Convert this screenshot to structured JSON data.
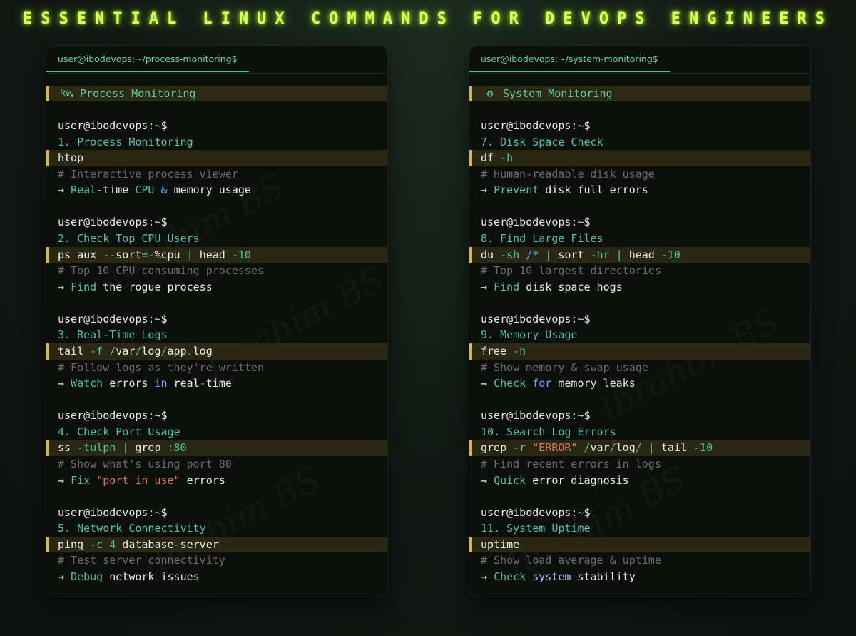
{
  "title": "ESSENTIAL LINUX COMMANDS FOR DEVOPS ENGINEERS",
  "watermark": "Ibrahim BS",
  "colors": {
    "accent_title": "#d8ff5a",
    "teal": "#4fc3a3",
    "highlight": "#d9b54a"
  },
  "panels": [
    {
      "tab": "user@ibodevops:~/process-monitoring$",
      "section_icon": "satellite-icon",
      "section_icon_glyph": "🛰",
      "section_title": "Process Monitoring",
      "entries": [
        {
          "prompt": "user@ibodevops:~$",
          "step": "1. Process Monitoring",
          "cmd": [
            {
              "t": "htop",
              "c": "white"
            }
          ],
          "comment": "# Interactive process viewer",
          "note": [
            {
              "t": "→ ",
              "c": "white"
            },
            {
              "t": "Real",
              "c": "teal"
            },
            {
              "t": "-",
              "c": "white"
            },
            {
              "t": "time ",
              "c": "white"
            },
            {
              "t": "CPU",
              "c": "teal"
            },
            {
              "t": " & ",
              "c": "blue"
            },
            {
              "t": "memory usage",
              "c": "white"
            }
          ]
        },
        {
          "prompt": "user@ibodevops:~$",
          "step": "2. Check Top CPU Users",
          "cmd": [
            {
              "t": "ps aux ",
              "c": "white"
            },
            {
              "t": "--",
              "c": "teal"
            },
            {
              "t": "sort",
              "c": "white"
            },
            {
              "t": "=-",
              "c": "teal"
            },
            {
              "t": "%cpu ",
              "c": "white"
            },
            {
              "t": "| ",
              "c": "teal"
            },
            {
              "t": "head ",
              "c": "white"
            },
            {
              "t": "-10",
              "c": "teal"
            }
          ],
          "comment": "# Top 10 CPU consuming processes",
          "note": [
            {
              "t": "→ ",
              "c": "white"
            },
            {
              "t": "Find",
              "c": "teal"
            },
            {
              "t": " the rogue process",
              "c": "white"
            }
          ]
        },
        {
          "prompt": "user@ibodevops:~$",
          "step": "3. Real-Time Logs",
          "cmd": [
            {
              "t": "tail ",
              "c": "white"
            },
            {
              "t": "-f ",
              "c": "teal"
            },
            {
              "t": "/",
              "c": "teal"
            },
            {
              "t": "var",
              "c": "white"
            },
            {
              "t": "/",
              "c": "teal"
            },
            {
              "t": "log",
              "c": "white"
            },
            {
              "t": "/",
              "c": "teal"
            },
            {
              "t": "app",
              "c": "white"
            },
            {
              "t": ".",
              "c": "teal"
            },
            {
              "t": "log",
              "c": "white"
            }
          ],
          "comment": "# Follow logs as they're written",
          "note": [
            {
              "t": "→ ",
              "c": "white"
            },
            {
              "t": "Watch",
              "c": "teal"
            },
            {
              "t": " errors ",
              "c": "white"
            },
            {
              "t": "in",
              "c": "blue"
            },
            {
              "t": " real",
              "c": "white"
            },
            {
              "t": "-",
              "c": "teal"
            },
            {
              "t": "time",
              "c": "white"
            }
          ]
        },
        {
          "prompt": "user@ibodevops:~$",
          "step": "4. Check Port Usage",
          "cmd": [
            {
              "t": "ss ",
              "c": "white"
            },
            {
              "t": "-tulpn ",
              "c": "teal"
            },
            {
              "t": "| ",
              "c": "teal"
            },
            {
              "t": "grep ",
              "c": "white"
            },
            {
              "t": ":80",
              "c": "teal"
            }
          ],
          "comment": "# Show what's using port 80",
          "note": [
            {
              "t": "→ ",
              "c": "white"
            },
            {
              "t": "Fix",
              "c": "teal"
            },
            {
              "t": " \"port in use\"",
              "c": "orange"
            },
            {
              "t": " errors",
              "c": "white"
            }
          ]
        },
        {
          "prompt": "user@ibodevops:~$",
          "step": "5. Network Connectivity",
          "cmd": [
            {
              "t": "ping ",
              "c": "white"
            },
            {
              "t": "-c ",
              "c": "teal"
            },
            {
              "t": "4",
              "c": "teal"
            },
            {
              "t": " database",
              "c": "white"
            },
            {
              "t": "-",
              "c": "teal"
            },
            {
              "t": "server",
              "c": "white"
            }
          ],
          "comment": "# Test server connectivity",
          "note": [
            {
              "t": "→ ",
              "c": "white"
            },
            {
              "t": "Debug",
              "c": "teal"
            },
            {
              "t": " network issues",
              "c": "white"
            }
          ]
        }
      ]
    },
    {
      "tab": "user@ibodevops:~/system-monitoring$",
      "section_icon": "gear-icon",
      "section_icon_glyph": "⚙",
      "section_title": "System Monitoring",
      "entries": [
        {
          "prompt": "user@ibodevops:~$",
          "step": "7. Disk Space Check",
          "cmd": [
            {
              "t": "df ",
              "c": "white"
            },
            {
              "t": "-h",
              "c": "teal"
            }
          ],
          "comment": "# Human-readable disk usage",
          "note": [
            {
              "t": "→ ",
              "c": "white"
            },
            {
              "t": "Prevent",
              "c": "teal"
            },
            {
              "t": " disk full errors",
              "c": "white"
            }
          ]
        },
        {
          "prompt": "user@ibodevops:~$",
          "step": "8. Find Large Files",
          "cmd": [
            {
              "t": "du ",
              "c": "white"
            },
            {
              "t": "-sh ",
              "c": "teal"
            },
            {
              "t": "/*",
              "c": "blue"
            },
            {
              "t": " | ",
              "c": "teal"
            },
            {
              "t": "sort ",
              "c": "white"
            },
            {
              "t": "-hr ",
              "c": "teal"
            },
            {
              "t": "| ",
              "c": "teal"
            },
            {
              "t": "head ",
              "c": "white"
            },
            {
              "t": "-10",
              "c": "teal"
            }
          ],
          "comment": "# Top 10 largest directories",
          "note": [
            {
              "t": "→ ",
              "c": "white"
            },
            {
              "t": "Find",
              "c": "teal"
            },
            {
              "t": " disk space hogs",
              "c": "white"
            }
          ]
        },
        {
          "prompt": "user@ibodevops:~$",
          "step": "9. Memory Usage",
          "cmd": [
            {
              "t": "free ",
              "c": "white"
            },
            {
              "t": "-h",
              "c": "teal"
            }
          ],
          "comment": "# Show memory & swap usage",
          "note": [
            {
              "t": "→ ",
              "c": "white"
            },
            {
              "t": "Check",
              "c": "teal"
            },
            {
              "t": " for",
              "c": "blue"
            },
            {
              "t": " memory leaks",
              "c": "white"
            }
          ]
        },
        {
          "prompt": "user@ibodevops:~$",
          "step": "10. Search Log Errors",
          "cmd": [
            {
              "t": "grep ",
              "c": "white"
            },
            {
              "t": "-r ",
              "c": "teal"
            },
            {
              "t": "\"ERROR\"",
              "c": "orange"
            },
            {
              "t": " /",
              "c": "teal"
            },
            {
              "t": "var",
              "c": "white"
            },
            {
              "t": "/",
              "c": "teal"
            },
            {
              "t": "log",
              "c": "white"
            },
            {
              "t": "/",
              "c": "teal"
            },
            {
              "t": " | ",
              "c": "teal"
            },
            {
              "t": "tail ",
              "c": "white"
            },
            {
              "t": "-10",
              "c": "teal"
            }
          ],
          "comment": "# Find recent errors in logs",
          "note": [
            {
              "t": "→ ",
              "c": "white"
            },
            {
              "t": "Quick",
              "c": "teal"
            },
            {
              "t": " error diagnosis",
              "c": "white"
            }
          ]
        },
        {
          "prompt": "user@ibodevops:~$",
          "step": "11. System Uptime",
          "cmd": [
            {
              "t": "uptime",
              "c": "white"
            }
          ],
          "comment": "# Show load average & uptime",
          "note": [
            {
              "t": "→ ",
              "c": "white"
            },
            {
              "t": "Check",
              "c": "teal"
            },
            {
              "t": " system",
              "c": "lblue"
            },
            {
              "t": " stability",
              "c": "white"
            }
          ]
        }
      ]
    }
  ]
}
